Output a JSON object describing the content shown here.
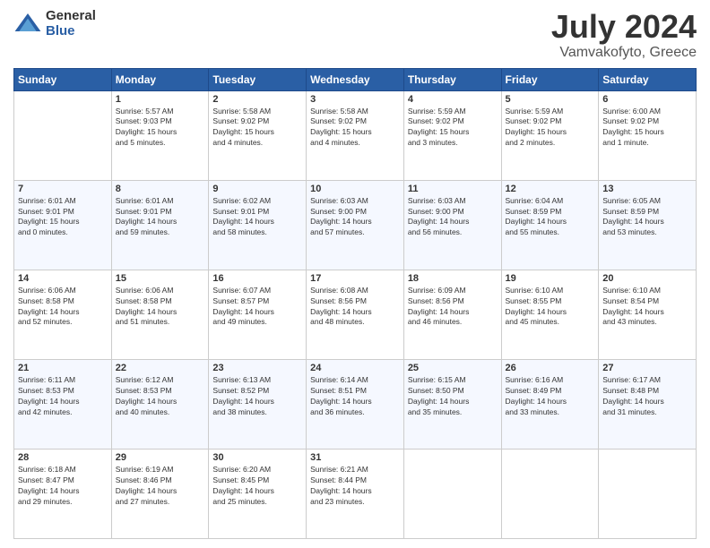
{
  "logo": {
    "general": "General",
    "blue": "Blue"
  },
  "header": {
    "title": "July 2024",
    "subtitle": "Vamvakofyto, Greece"
  },
  "weekdays": [
    "Sunday",
    "Monday",
    "Tuesday",
    "Wednesday",
    "Thursday",
    "Friday",
    "Saturday"
  ],
  "weeks": [
    [
      {
        "day": "",
        "info": ""
      },
      {
        "day": "1",
        "info": "Sunrise: 5:57 AM\nSunset: 9:03 PM\nDaylight: 15 hours\nand 5 minutes."
      },
      {
        "day": "2",
        "info": "Sunrise: 5:58 AM\nSunset: 9:02 PM\nDaylight: 15 hours\nand 4 minutes."
      },
      {
        "day": "3",
        "info": "Sunrise: 5:58 AM\nSunset: 9:02 PM\nDaylight: 15 hours\nand 4 minutes."
      },
      {
        "day": "4",
        "info": "Sunrise: 5:59 AM\nSunset: 9:02 PM\nDaylight: 15 hours\nand 3 minutes."
      },
      {
        "day": "5",
        "info": "Sunrise: 5:59 AM\nSunset: 9:02 PM\nDaylight: 15 hours\nand 2 minutes."
      },
      {
        "day": "6",
        "info": "Sunrise: 6:00 AM\nSunset: 9:02 PM\nDaylight: 15 hours\nand 1 minute."
      }
    ],
    [
      {
        "day": "7",
        "info": "Sunrise: 6:01 AM\nSunset: 9:01 PM\nDaylight: 15 hours\nand 0 minutes."
      },
      {
        "day": "8",
        "info": "Sunrise: 6:01 AM\nSunset: 9:01 PM\nDaylight: 14 hours\nand 59 minutes."
      },
      {
        "day": "9",
        "info": "Sunrise: 6:02 AM\nSunset: 9:01 PM\nDaylight: 14 hours\nand 58 minutes."
      },
      {
        "day": "10",
        "info": "Sunrise: 6:03 AM\nSunset: 9:00 PM\nDaylight: 14 hours\nand 57 minutes."
      },
      {
        "day": "11",
        "info": "Sunrise: 6:03 AM\nSunset: 9:00 PM\nDaylight: 14 hours\nand 56 minutes."
      },
      {
        "day": "12",
        "info": "Sunrise: 6:04 AM\nSunset: 8:59 PM\nDaylight: 14 hours\nand 55 minutes."
      },
      {
        "day": "13",
        "info": "Sunrise: 6:05 AM\nSunset: 8:59 PM\nDaylight: 14 hours\nand 53 minutes."
      }
    ],
    [
      {
        "day": "14",
        "info": "Sunrise: 6:06 AM\nSunset: 8:58 PM\nDaylight: 14 hours\nand 52 minutes."
      },
      {
        "day": "15",
        "info": "Sunrise: 6:06 AM\nSunset: 8:58 PM\nDaylight: 14 hours\nand 51 minutes."
      },
      {
        "day": "16",
        "info": "Sunrise: 6:07 AM\nSunset: 8:57 PM\nDaylight: 14 hours\nand 49 minutes."
      },
      {
        "day": "17",
        "info": "Sunrise: 6:08 AM\nSunset: 8:56 PM\nDaylight: 14 hours\nand 48 minutes."
      },
      {
        "day": "18",
        "info": "Sunrise: 6:09 AM\nSunset: 8:56 PM\nDaylight: 14 hours\nand 46 minutes."
      },
      {
        "day": "19",
        "info": "Sunrise: 6:10 AM\nSunset: 8:55 PM\nDaylight: 14 hours\nand 45 minutes."
      },
      {
        "day": "20",
        "info": "Sunrise: 6:10 AM\nSunset: 8:54 PM\nDaylight: 14 hours\nand 43 minutes."
      }
    ],
    [
      {
        "day": "21",
        "info": "Sunrise: 6:11 AM\nSunset: 8:53 PM\nDaylight: 14 hours\nand 42 minutes."
      },
      {
        "day": "22",
        "info": "Sunrise: 6:12 AM\nSunset: 8:53 PM\nDaylight: 14 hours\nand 40 minutes."
      },
      {
        "day": "23",
        "info": "Sunrise: 6:13 AM\nSunset: 8:52 PM\nDaylight: 14 hours\nand 38 minutes."
      },
      {
        "day": "24",
        "info": "Sunrise: 6:14 AM\nSunset: 8:51 PM\nDaylight: 14 hours\nand 36 minutes."
      },
      {
        "day": "25",
        "info": "Sunrise: 6:15 AM\nSunset: 8:50 PM\nDaylight: 14 hours\nand 35 minutes."
      },
      {
        "day": "26",
        "info": "Sunrise: 6:16 AM\nSunset: 8:49 PM\nDaylight: 14 hours\nand 33 minutes."
      },
      {
        "day": "27",
        "info": "Sunrise: 6:17 AM\nSunset: 8:48 PM\nDaylight: 14 hours\nand 31 minutes."
      }
    ],
    [
      {
        "day": "28",
        "info": "Sunrise: 6:18 AM\nSunset: 8:47 PM\nDaylight: 14 hours\nand 29 minutes."
      },
      {
        "day": "29",
        "info": "Sunrise: 6:19 AM\nSunset: 8:46 PM\nDaylight: 14 hours\nand 27 minutes."
      },
      {
        "day": "30",
        "info": "Sunrise: 6:20 AM\nSunset: 8:45 PM\nDaylight: 14 hours\nand 25 minutes."
      },
      {
        "day": "31",
        "info": "Sunrise: 6:21 AM\nSunset: 8:44 PM\nDaylight: 14 hours\nand 23 minutes."
      },
      {
        "day": "",
        "info": ""
      },
      {
        "day": "",
        "info": ""
      },
      {
        "day": "",
        "info": ""
      }
    ]
  ]
}
